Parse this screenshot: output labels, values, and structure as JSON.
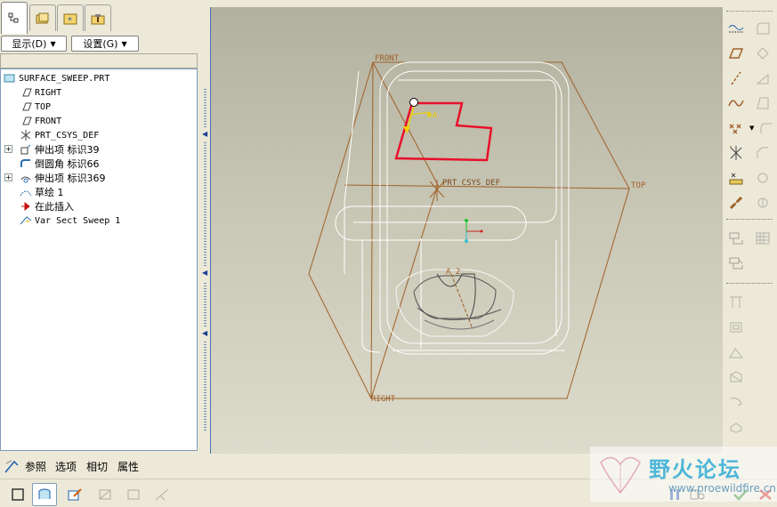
{
  "left_panel": {
    "tabs": [
      {
        "name": "model-tree-tab",
        "active": true
      },
      {
        "name": "layers-tab",
        "active": false
      },
      {
        "name": "favorites-tab",
        "active": false
      },
      {
        "name": "tools-tab",
        "active": false
      }
    ],
    "show_menu_label": "显示(D)",
    "settings_menu_label": "设置(G)",
    "tree": [
      {
        "label": "SURFACE_SWEEP.PRT",
        "icon": "part-icon",
        "expandable": false
      },
      {
        "label": "RIGHT",
        "icon": "datum-plane-icon",
        "expandable": false
      },
      {
        "label": "TOP",
        "icon": "datum-plane-icon",
        "expandable": false
      },
      {
        "label": "FRONT",
        "icon": "datum-plane-icon",
        "expandable": false
      },
      {
        "label": "PRT_CSYS_DEF",
        "icon": "coordinate-system-icon",
        "expandable": false
      },
      {
        "label": "伸出项 标识39",
        "icon": "extrude-icon",
        "expandable": true
      },
      {
        "label": "倒圆角 标识66",
        "icon": "round-icon",
        "expandable": false
      },
      {
        "label": "伸出项 标识369",
        "icon": "extrude-icon",
        "expandable": true
      },
      {
        "label": "草绘 1",
        "icon": "sketch-icon",
        "expandable": false
      },
      {
        "label": "在此插入",
        "icon": "insert-here-arrow-icon",
        "expandable": false
      },
      {
        "label": "Var Sect Sweep 1",
        "icon": "var-sect-sweep-icon",
        "expandable": false
      }
    ]
  },
  "viewport": {
    "labels": {
      "front": "FRONT",
      "top": "TOP",
      "right": "RIGHT",
      "csys": "PRT_CSYS_DEF",
      "axis": "A_2"
    }
  },
  "dashboard": {
    "tabs": [
      "参照",
      "选项",
      "相切",
      "属性"
    ]
  },
  "watermark": {
    "title": "野火论坛",
    "url": "www.proewildfire.cn"
  },
  "colors": {
    "datum": "#a0612a",
    "sketch": "#e8102a",
    "edges": "#ffffff",
    "highlight": "#f0d000",
    "cancel": "#d02020",
    "accept": "#2c8a2c"
  }
}
